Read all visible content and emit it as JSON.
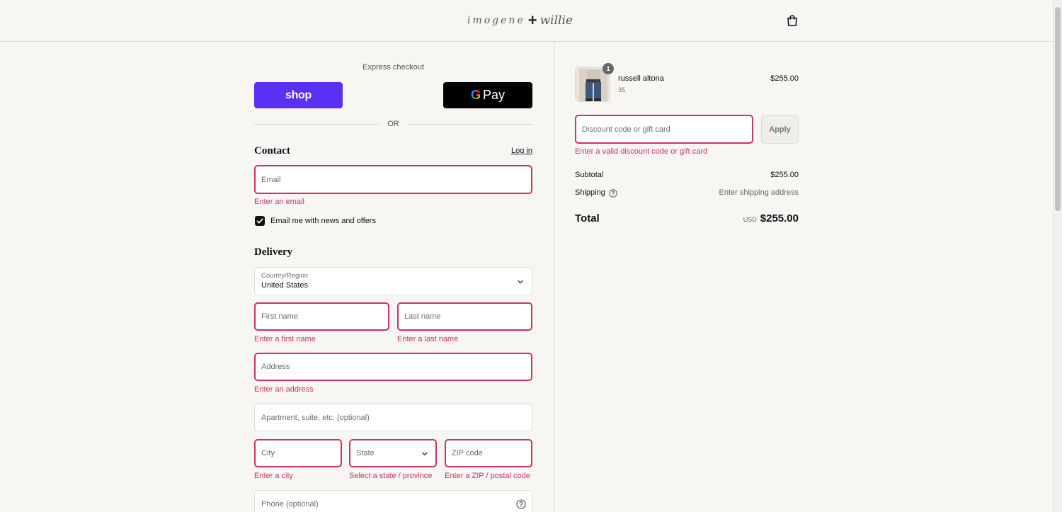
{
  "header": {
    "logo_word": "imogene",
    "logo_plus": "+",
    "logo_script": "willie"
  },
  "express": {
    "label": "Express checkout",
    "shop_label": "shop",
    "gpay_g": "G",
    "gpay_label": "Pay",
    "or_label": "OR"
  },
  "contact": {
    "title": "Contact",
    "login_label": "Log in",
    "email_placeholder": "Email",
    "email_error": "Enter an email",
    "newsletter_label": "Email me with news and offers",
    "newsletter_checked": true
  },
  "delivery": {
    "title": "Delivery",
    "country_label": "Country/Region",
    "country_value": "United States",
    "first_name_placeholder": "First name",
    "first_name_error": "Enter a first name",
    "last_name_placeholder": "Last name",
    "last_name_error": "Enter a last name",
    "address_placeholder": "Address",
    "address_error": "Enter an address",
    "apartment_placeholder": "Apartment, suite, etc. (optional)",
    "city_placeholder": "City",
    "city_error": "Enter a city",
    "state_placeholder": "State",
    "state_error": "Select a state / province",
    "zip_placeholder": "ZIP code",
    "zip_error": "Enter a ZIP / postal code",
    "phone_placeholder": "Phone (optional)"
  },
  "order": {
    "item": {
      "quantity": "1",
      "name": "russell altona",
      "variant": "35",
      "price": "$255.00"
    },
    "discount_placeholder": "Discount code or gift card",
    "apply_label": "Apply",
    "discount_error": "Enter a valid discount code or gift card",
    "subtotal_label": "Subtotal",
    "subtotal_value": "$255.00",
    "shipping_label": "Shipping",
    "shipping_value": "Enter shipping address",
    "total_label": "Total",
    "total_currency": "USD",
    "total_value": "$255.00"
  },
  "colors": {
    "error": "#cc3366",
    "shop_brand": "#5a31f4",
    "background": "#f7f6f3"
  }
}
